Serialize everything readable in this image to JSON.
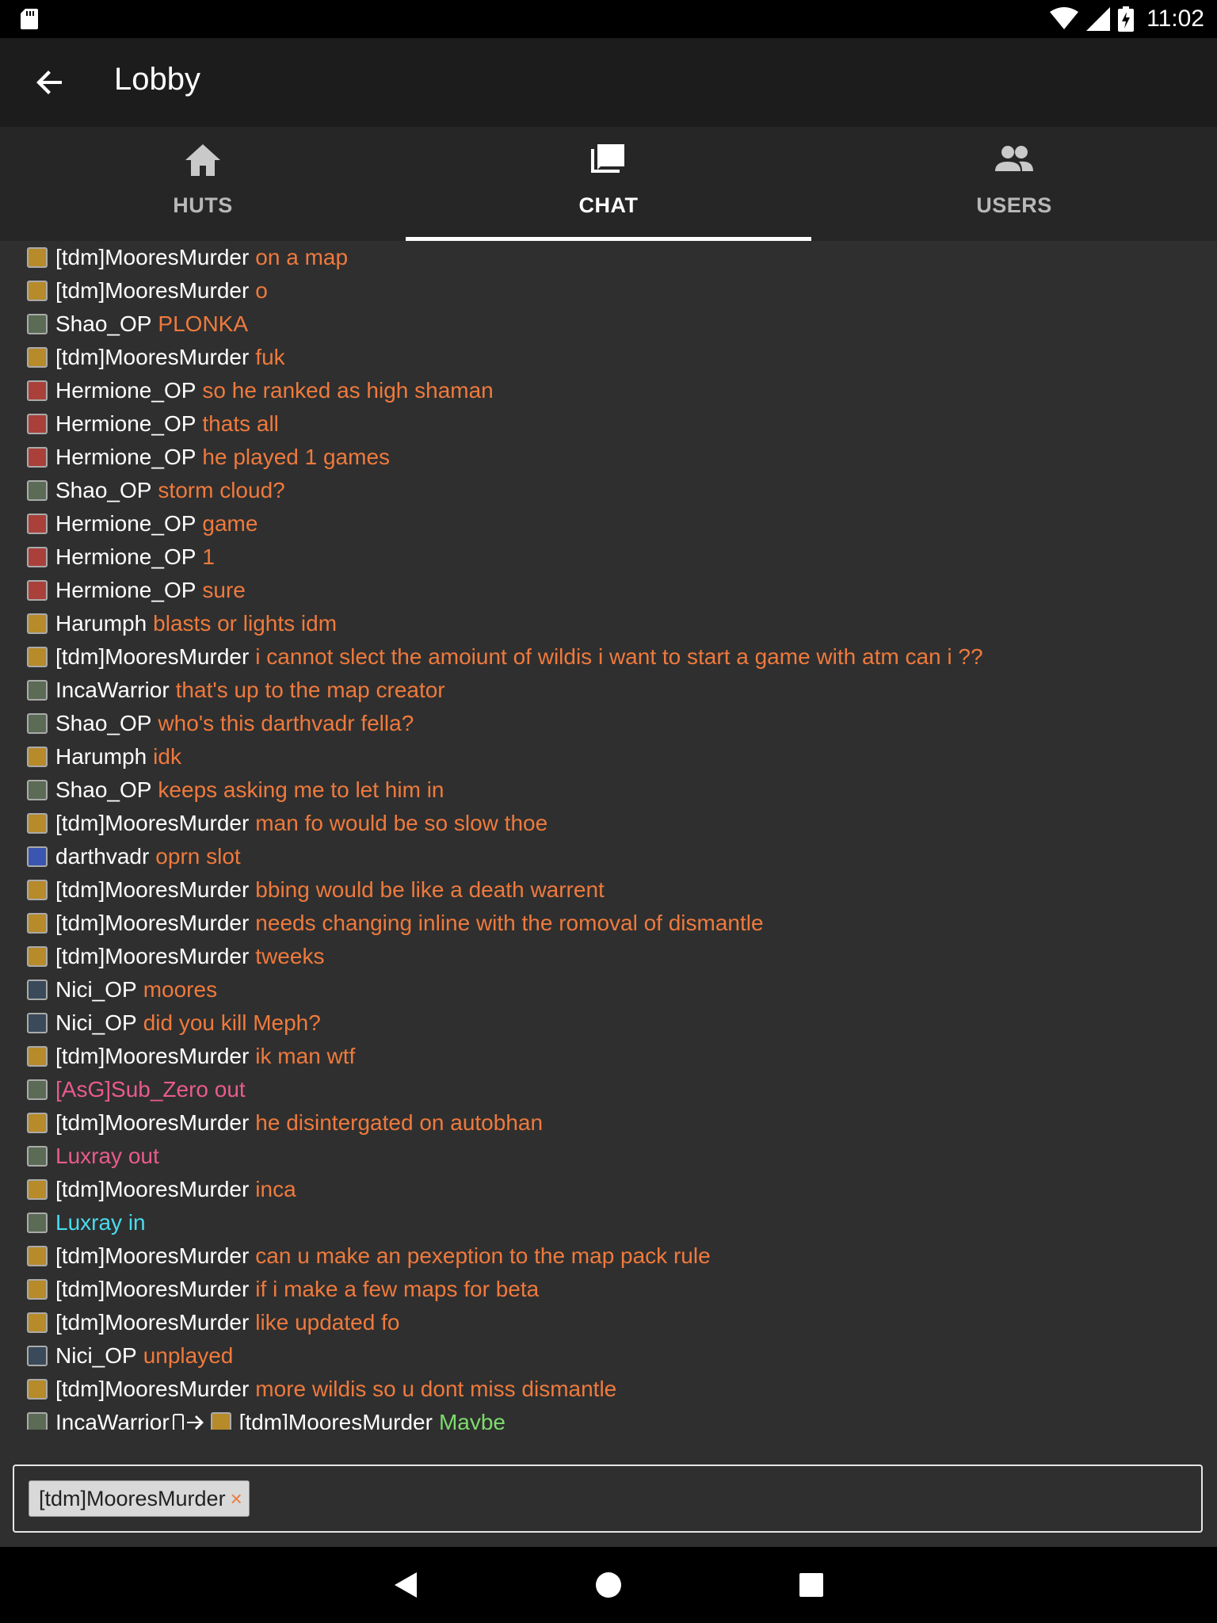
{
  "status": {
    "time": "11:02"
  },
  "appbar": {
    "title": "Lobby"
  },
  "tabs": [
    {
      "label": "HUTS",
      "icon": "home-icon",
      "active": false
    },
    {
      "label": "CHAT",
      "icon": "chat-icon",
      "active": true
    },
    {
      "label": "USERS",
      "icon": "users-icon",
      "active": false
    }
  ],
  "colors": {
    "user": "#ffffff",
    "message": "#ef7a3d",
    "leave": "#e95b8d",
    "join": "#49dcf0",
    "whisper": "#7ddc6b"
  },
  "messages": [
    {
      "user": "[tdm]MooresMurder",
      "text": "on a map",
      "avatar": "#b78a2a"
    },
    {
      "user": "[tdm]MooresMurder",
      "text": "o",
      "avatar": "#b78a2a"
    },
    {
      "user": "Shao_OP",
      "text": "PLONKA",
      "avatar": "#5b6b56"
    },
    {
      "user": "[tdm]MooresMurder",
      "text": "fuk",
      "avatar": "#b78a2a"
    },
    {
      "user": "Hermione_OP",
      "text": "so he ranked as high shaman",
      "avatar": "#a9413a"
    },
    {
      "user": "Hermione_OP",
      "text": "thats all",
      "avatar": "#a9413a"
    },
    {
      "user": "Hermione_OP",
      "text": "he played 1 games",
      "avatar": "#a9413a"
    },
    {
      "user": "Shao_OP",
      "text": "storm cloud?",
      "avatar": "#5b6b56"
    },
    {
      "user": "Hermione_OP",
      "text": "game",
      "avatar": "#a9413a"
    },
    {
      "user": "Hermione_OP",
      "text": "1",
      "avatar": "#a9413a"
    },
    {
      "user": "Hermione_OP",
      "text": "sure",
      "avatar": "#a9413a"
    },
    {
      "user": "Harumph",
      "text": "blasts or lights idm",
      "avatar": "#b78a2a"
    },
    {
      "user": "[tdm]MooresMurder",
      "text": "i cannot slect the amoiunt of wildis i want to start a game with atm can i ??",
      "avatar": "#b78a2a"
    },
    {
      "user": "IncaWarrior",
      "text": "that's up to the map creator",
      "avatar": "#5b6b56"
    },
    {
      "user": "Shao_OP",
      "text": "who's this darthvadr fella?",
      "avatar": "#5b6b56"
    },
    {
      "user": "Harumph",
      "text": "idk",
      "avatar": "#b78a2a"
    },
    {
      "user": "Shao_OP",
      "text": "keeps asking me to let him in",
      "avatar": "#5b6b56"
    },
    {
      "user": "[tdm]MooresMurder",
      "text": "man fo would be so slow thoe",
      "avatar": "#b78a2a"
    },
    {
      "user": "darthvadr",
      "text": "oprn slot",
      "avatar": "#3b56b0"
    },
    {
      "user": "[tdm]MooresMurder",
      "text": "bbing would be like a death warrent",
      "avatar": "#b78a2a"
    },
    {
      "user": "[tdm]MooresMurder",
      "text": "needs changing inline with the romoval of dismantle",
      "avatar": "#b78a2a"
    },
    {
      "user": "[tdm]MooresMurder",
      "text": "tweeks",
      "avatar": "#b78a2a"
    },
    {
      "user": "Nici_OP",
      "text": "moores",
      "avatar": "#3a4a5a"
    },
    {
      "user": "Nici_OP",
      "text": "did you kill Meph?",
      "avatar": "#3a4a5a"
    },
    {
      "user": "[tdm]MooresMurder",
      "text": "ik man wtf",
      "avatar": "#b78a2a"
    },
    {
      "user": "",
      "text": "[AsG]Sub_Zero out",
      "avatar": "#5b6b56",
      "kind": "pink"
    },
    {
      "user": "[tdm]MooresMurder",
      "text": "he disintergated on autobhan",
      "avatar": "#b78a2a"
    },
    {
      "user": "",
      "text": "Luxray out",
      "avatar": "#5b6b56",
      "kind": "pink"
    },
    {
      "user": "[tdm]MooresMurder",
      "text": "inca",
      "avatar": "#b78a2a"
    },
    {
      "user": "",
      "text": "Luxray in",
      "avatar": "#5b6b56",
      "kind": "cyan"
    },
    {
      "user": "[tdm]MooresMurder",
      "text": "can u make an pexeption to the map pack rule",
      "avatar": "#b78a2a"
    },
    {
      "user": "[tdm]MooresMurder",
      "text": "if i make a few maps for beta",
      "avatar": "#b78a2a"
    },
    {
      "user": "[tdm]MooresMurder",
      "text": "like updated fo",
      "avatar": "#b78a2a"
    },
    {
      "user": "Nici_OP",
      "text": "unplayed",
      "avatar": "#3a4a5a"
    },
    {
      "user": "[tdm]MooresMurder",
      "text": "more wildis so u dont miss dismantle",
      "avatar": "#b78a2a"
    }
  ],
  "whisper": {
    "from": "IncaWarrior",
    "to": "[tdm]MooresMurder",
    "text": "Maybe",
    "from_avatar": "#5b6b56",
    "to_avatar": "#b78a2a"
  },
  "input": {
    "recipient_chip": "[tdm]MooresMurder",
    "chip_remove": "×"
  }
}
